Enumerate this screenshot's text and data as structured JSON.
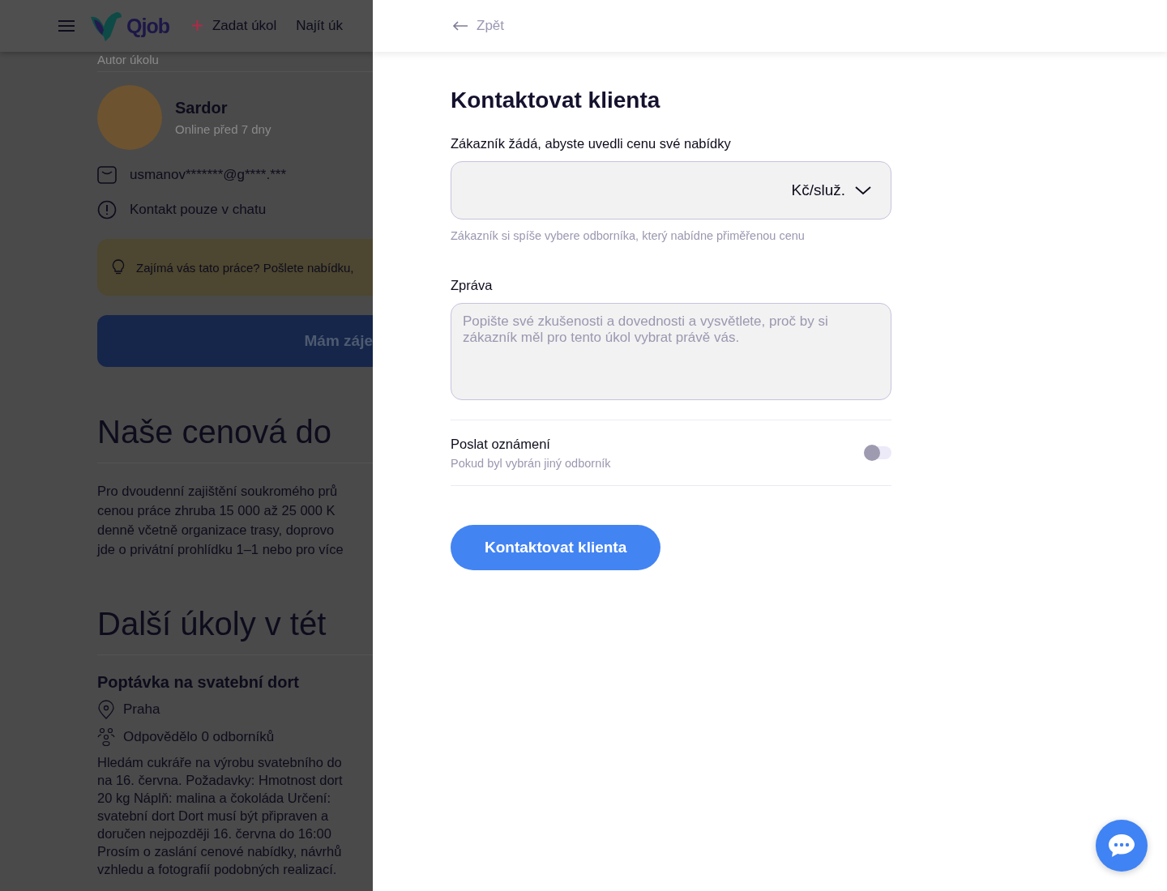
{
  "header": {
    "logo": "Qjob",
    "nav": [
      {
        "kind": "add",
        "label": "Zadat úkol"
      },
      {
        "kind": "plain",
        "label": "Najít úk"
      }
    ]
  },
  "author": {
    "section_label": "Autor úkolu",
    "name": "Sardor",
    "status": "Online před 7 dny",
    "contacts": [
      {
        "kind": "email",
        "text": "usmanov*******@g****.***"
      },
      {
        "kind": "info",
        "text": "Kontakt pouze v chatu"
      }
    ]
  },
  "hint": "Zajímá vás tato práce? Pošlete nabídku,",
  "interest_button": "Mám záje",
  "price_section": {
    "title": "Naše cenová do",
    "text": "Pro dvoudenní zajištění soukromého prů\ncenou práce zhruba 15 000 až 25 000 K\ndenně včetně organizace trasy, doprovo\njde o privátní prohlídku 1–1 nebo pro více"
  },
  "other_tasks": {
    "title": "Další úkoly v tét",
    "task": {
      "title": "Poptávka na svatební dort",
      "location": "Praha",
      "responses": "Odpovědělo 0 odborníků",
      "text": "Hledám cukráře na výrobu svatebního do\nna 16. června. Požadavky: Hmotnost dort\n20 kg Náplň: malina a čokoláda Určení:\nsvatební dort Dort musí být připraven a\ndoručen nejpozději 16. června do 16:00\nProsím o zaslání cenové nabídky, návrhů\nvzhledu a fotografií podobných realizací."
    }
  },
  "panel": {
    "back": "Zpět",
    "title": "Kontaktovat klienta",
    "price_label": "Zákazník žádá, abyste uvedli cenu své nabídky",
    "unit": "Kč/služ.",
    "price_hint": "Zákazník si spíše vybere odborníka, který nabídne přiměřenou cenu",
    "message_label": "Zpráva",
    "message_placeholder": "Popište své zkušenosti a dovednosti a vysvětlete, proč by si zákazník měl pro tento úkol vybrat právě vás.",
    "notify": {
      "title": "Poslat oznámení",
      "subtitle": "Pokud byl vybrán jiný odborník",
      "on": false
    },
    "submit": "Kontaktovat klienta"
  }
}
